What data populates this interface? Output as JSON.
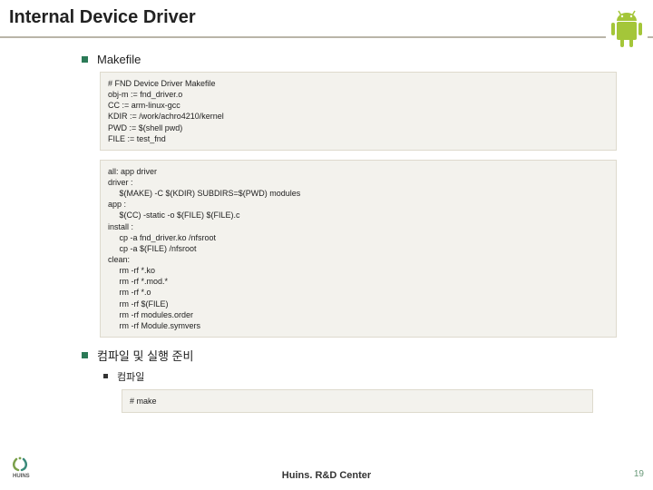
{
  "title": "Internal Device Driver",
  "sections": {
    "makefile_label": "Makefile",
    "codebox1": "# FND Device Driver Makefile\nobj-m := fnd_driver.o\nCC := arm-linux-gcc\nKDIR := /work/achro4210/kernel\nPWD := $(shell pwd)\nFILE := test_fnd",
    "codebox2": "all: app driver\ndriver :\n     $(MAKE) -C $(KDIR) SUBDIRS=$(PWD) modules\napp :\n     $(CC) -static -o $(FILE) $(FILE).c\ninstall :\n     cp -a fnd_driver.ko /nfsroot\n     cp -a $(FILE) /nfsroot\nclean:\n     rm -rf *.ko\n     rm -rf *.mod.*\n     rm -rf *.o\n     rm -rf $(FILE)\n     rm -rf modules.order\n     rm -rf Module.symvers",
    "compile_label": "컴파일 및 실행 준비",
    "compile_sub": "컴파일",
    "codebox3": "# make"
  },
  "footer": {
    "center": "Huins. R&D Center",
    "pagenum": "19",
    "logo_text": "HUINS"
  }
}
